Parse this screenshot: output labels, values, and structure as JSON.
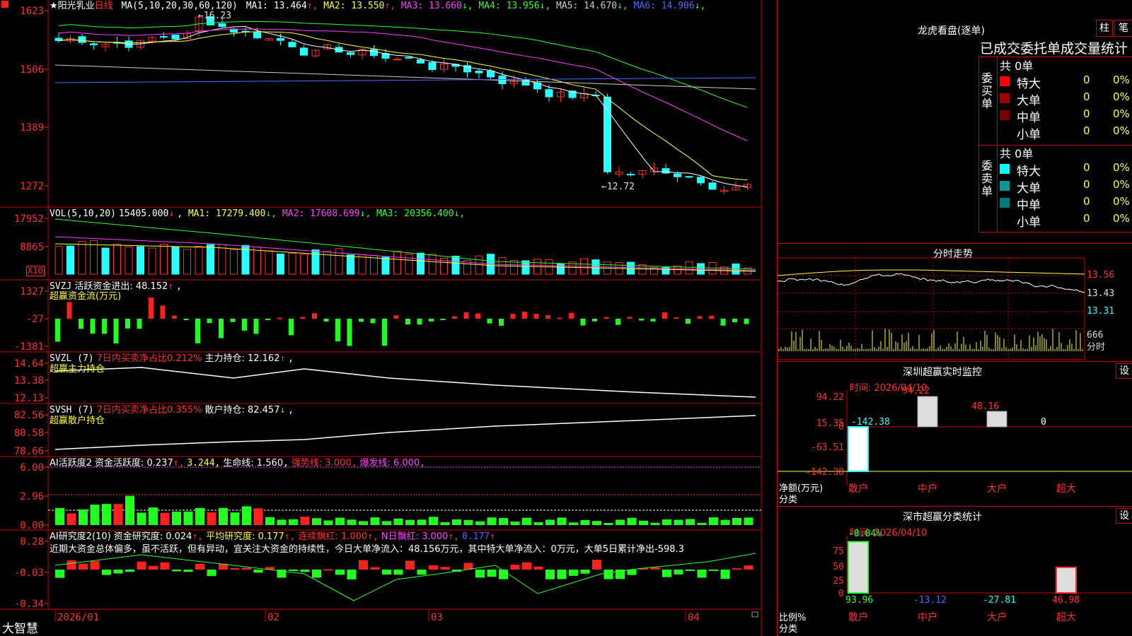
{
  "app": {
    "name": "大智慧",
    "corner_icon": "stock-marker-icon"
  },
  "stock": {
    "name": "★阳光乳业",
    "period": "日线"
  },
  "price_panel": {
    "ma_prefix": "MA(5,10,20,30,60,120)",
    "ma": [
      {
        "label": "MA1: 13.464",
        "arrow": "↑",
        "color": "#ffffff"
      },
      {
        "label": "MA2: 13.550",
        "arrow": "↑",
        "color": "#ffff3a"
      },
      {
        "label": "MA3: 13.660",
        "arrow": "↓",
        "color": "#ff40ff"
      },
      {
        "label": "MA4: 13.956",
        "arrow": "↓",
        "color": "#30ff30"
      },
      {
        "label": "MA5: 14.670",
        "arrow": "↓",
        "color": "#cccccc"
      },
      {
        "label": "MA6: 14.906",
        "arrow": "↓",
        "color": "#4a6cff"
      }
    ],
    "yticks": [
      "1623",
      "1506",
      "1389",
      "1272"
    ],
    "high_label": "16.23",
    "low_label": "←12.72"
  },
  "vol_panel": {
    "prefix": "VOL(5,10,20)",
    "value": "15405.000",
    "arrow": "↓",
    "ma": [
      {
        "label": "MA1: 17279.400",
        "arrow": "↓",
        "color": "#ffff3a"
      },
      {
        "label": "MA2: 17608.699",
        "arrow": "↓",
        "color": "#ff40ff"
      },
      {
        "label": "MA3: 20356.400",
        "arrow": "↓",
        "color": "#30ff30"
      }
    ],
    "yticks": [
      "17952",
      "8865"
    ],
    "unit": "X10"
  },
  "svzj_panel": {
    "prefix": "SVZJ",
    "label": "活跃资金进出: 48.152",
    "arrow": "↑",
    "sub": "超赢资金流(万元)",
    "yticks": [
      "1327",
      "-27",
      "-1381"
    ]
  },
  "svzl_panel": {
    "prefix": "SVZL (7)",
    "ratio": "7日内买卖净占比0.212%",
    "hold": "主力持仓: 12.162",
    "arrow": "↑",
    "sub": "超赢主力持仓",
    "yticks": [
      "14.64",
      "13.38",
      "12.13"
    ]
  },
  "svsh_panel": {
    "prefix": "SVSH (7)",
    "ratio": "7日内买卖净占比0.355%",
    "hold": "散户持仓: 82.457",
    "arrow": "↓",
    "sub": "超赢散户持仓",
    "yticks": [
      "82.56",
      "80.58",
      "78.66"
    ]
  },
  "ai_active_panel": {
    "prefix": "AI活跃度2",
    "label": "资金活跃度: 0.237",
    "val2": "3.244",
    "life": "生命线: 1.560",
    "strong": "强势线: 3.000",
    "burst": "爆发线: 6.000",
    "yticks": [
      "6.00",
      "2.96",
      "0.00"
    ]
  },
  "ai_research_panel": {
    "prefix": "AI研究度2(10)",
    "label": "资金研究度: 0.024",
    "avg": "平均研究度: 0.177",
    "cont": "连续飘红: 1.000",
    "nday": "N日飘红: 3.000",
    "last": "0.177",
    "comment": "近期大资金总体偏多，虽不活跃，但有异动，宜关注大资金的持续性，今日大单净流入：48.156万元，其中特大单净流入：0万元，大单5日累计净出-598.3",
    "yticks": [
      "0.28",
      "-0.03",
      "-0.34"
    ]
  },
  "date_axis": [
    "2026/01",
    "02",
    "03",
    "04"
  ],
  "lhb": {
    "title": "龙虎看盘(逐单)",
    "btn_bar": "柱",
    "btn_brush": "笔",
    "header": "已成交委托单成交量统计",
    "buy": {
      "side_label": "委买单",
      "total": "共 0单",
      "rows": [
        {
          "name": "特大",
          "vol": "0",
          "pct": "0%",
          "color": "#ff0000"
        },
        {
          "name": "大单",
          "vol": "0",
          "pct": "0%",
          "color": "#a00000"
        },
        {
          "name": "中单",
          "vol": "0",
          "pct": "0%",
          "color": "#7a0000"
        },
        {
          "name": "小单",
          "vol": "0",
          "pct": "0%",
          "color": ""
        }
      ]
    },
    "sell": {
      "side_label": "委卖单",
      "total": "共 0单",
      "rows": [
        {
          "name": "特大",
          "vol": "0",
          "pct": "0%",
          "color": "#00ffff"
        },
        {
          "name": "大单",
          "vol": "0",
          "pct": "0%",
          "color": "#009a9a"
        },
        {
          "name": "中单",
          "vol": "0",
          "pct": "0%",
          "color": "#007a7a"
        },
        {
          "name": "小单",
          "vol": "0",
          "pct": "0%",
          "color": ""
        }
      ]
    }
  },
  "intraday": {
    "title": "分时走势",
    "price_ticks": [
      "13.56",
      "13.43",
      "13.31"
    ],
    "vol_tick": "666",
    "vol_unit": "分时"
  },
  "sz_monitor": {
    "title": "深圳超赢实时监控",
    "settings_label": "设",
    "date": "时间: 2026/04/10",
    "yticks": [
      "94.22",
      "15.35",
      "0",
      "-63.51",
      "-142.38"
    ],
    "axis_title": "净额(万元)",
    "axis_sub": "分类",
    "categories": [
      "散户",
      "中户",
      "大户",
      "超大"
    ],
    "values": [
      "-142.38",
      "94.22",
      "48.16",
      "0"
    ]
  },
  "sz_class": {
    "title": "深市超赢分类统计",
    "settings_label": "设",
    "date": "时间: 2026/04/10",
    "top_label": "-0.04%",
    "yticks": [
      "75",
      "50",
      "25",
      "0"
    ],
    "axis_title": "比例%",
    "axis_sub": "分类",
    "categories": [
      "散户",
      "中户",
      "大户",
      "超大"
    ],
    "values": [
      "93.96",
      "-13.12",
      "-27.81",
      "46.98"
    ]
  },
  "lock_icon": "lock-icon"
}
